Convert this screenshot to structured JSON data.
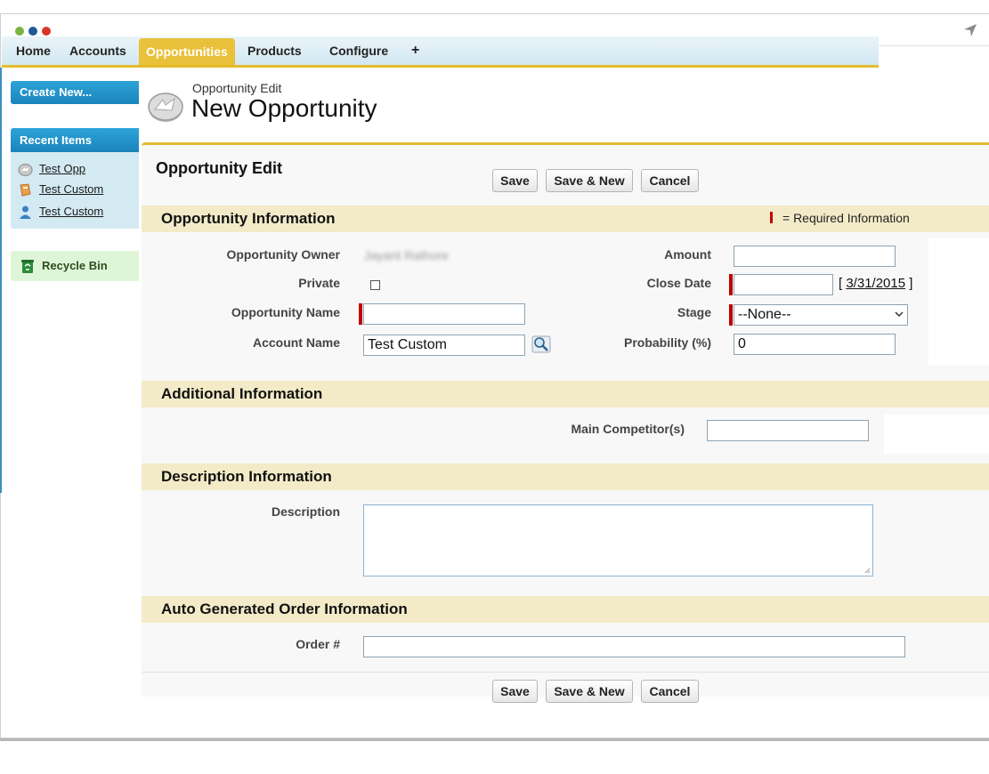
{
  "window": {
    "dot_colors": [
      "#7cb342",
      "#1e5a96",
      "#d9342b"
    ]
  },
  "tabs": [
    {
      "label": "Home",
      "active": false
    },
    {
      "label": "Accounts",
      "active": false
    },
    {
      "label": "Opportunities",
      "active": true
    },
    {
      "label": "Products",
      "active": false
    },
    {
      "label": "Configure",
      "active": false
    },
    {
      "label": "+",
      "active": false
    }
  ],
  "sidebar": {
    "create_new": "Create New...",
    "recent_title": "Recent Items",
    "recent_items": [
      {
        "label": "Test Opp",
        "icon": "opportunity-icon"
      },
      {
        "label": "Test Custom",
        "icon": "custom-object-icon"
      },
      {
        "label": "Test Custom",
        "icon": "contact-icon"
      }
    ],
    "recycle_bin": "Recycle Bin"
  },
  "header": {
    "subtitle": "Opportunity Edit",
    "title": "New Opportunity"
  },
  "panel": {
    "title": "Opportunity Edit",
    "buttons": {
      "save": "Save",
      "save_new": "Save & New",
      "cancel": "Cancel"
    }
  },
  "sections": {
    "opportunity": {
      "title": "Opportunity Information",
      "required_legend": "= Required Information",
      "fields": {
        "owner": {
          "label": "Opportunity Owner",
          "value": "Jayant Rathore"
        },
        "private": {
          "label": "Private",
          "checked": false
        },
        "name": {
          "label": "Opportunity Name",
          "value": ""
        },
        "account": {
          "label": "Account Name",
          "value": "Test Custom"
        },
        "amount": {
          "label": "Amount",
          "value": ""
        },
        "close_date": {
          "label": "Close Date",
          "value": "",
          "date_link": "3/31/2015"
        },
        "stage": {
          "label": "Stage",
          "value": "--None--"
        },
        "probability": {
          "label": "Probability (%)",
          "value": "0"
        }
      }
    },
    "additional": {
      "title": "Additional Information",
      "fields": {
        "competitors": {
          "label": "Main Competitor(s)",
          "value": ""
        }
      }
    },
    "description": {
      "title": "Description Information",
      "fields": {
        "description": {
          "label": "Description",
          "value": ""
        }
      }
    },
    "order": {
      "title": "Auto Generated Order Information",
      "fields": {
        "order_number": {
          "label": "Order #",
          "value": ""
        }
      }
    }
  },
  "colors": {
    "accent_gold": "#e4bb2d",
    "sidebar_blue": "#1a84bb",
    "required_red": "#c00000",
    "section_bg": "#f3ebc8"
  }
}
